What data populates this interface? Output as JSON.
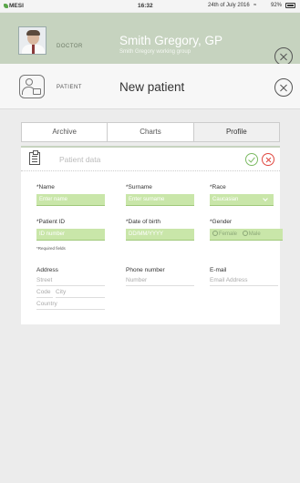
{
  "status_bar": {
    "brand": "MESI",
    "time": "16:32",
    "date": "24th of July 2016",
    "wifi_glyph": "≈",
    "battery": "92%"
  },
  "doctor": {
    "role": "DOCTOR",
    "name": "Smith Gregory, GP",
    "group": "Smith Gregory working group"
  },
  "patient": {
    "label": "PATIENT",
    "title": "New patient"
  },
  "tabs": [
    {
      "label": "Archive",
      "active": false
    },
    {
      "label": "Charts",
      "active": false
    },
    {
      "label": "Profile",
      "active": true
    }
  ],
  "form": {
    "title": "Patient data",
    "name": {
      "label": "*Name",
      "placeholder": "Enter name"
    },
    "surname": {
      "label": "*Surname",
      "placeholder": "Enter surname"
    },
    "race": {
      "label": "*Race",
      "value": "Caucasian"
    },
    "patient_id": {
      "label": "*Patient ID",
      "placeholder": "ID number"
    },
    "dob": {
      "label": "*Date of birth",
      "placeholder": "DD/MM/YYYY"
    },
    "gender": {
      "label": "*Gender",
      "options": [
        "Female",
        "Male"
      ]
    },
    "required_note": "*Required fields",
    "address": {
      "label": "Address",
      "street": "Street",
      "code": "Code",
      "city": "City",
      "country": "Country"
    },
    "phone": {
      "label": "Phone number",
      "placeholder": "Number"
    },
    "email": {
      "label": "E-mail",
      "placeholder": "Email Address"
    }
  },
  "colors": {
    "accent": "#c6d3bf",
    "field_bg": "#c9e6a9",
    "ok": "#7cba63",
    "cancel": "#e0473f"
  }
}
